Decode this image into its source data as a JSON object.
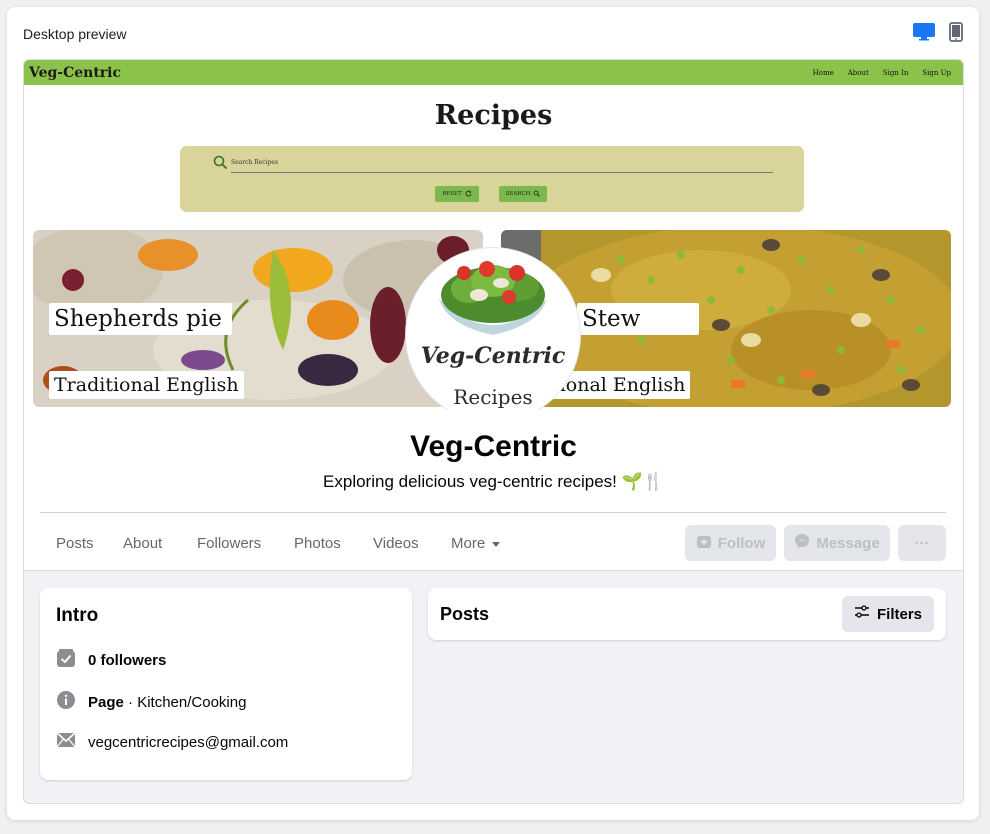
{
  "preview": {
    "title": "Desktop preview",
    "desktop_icon": "desktop-monitor-icon",
    "mobile_icon": "mobile-phone-icon",
    "active_color": "#1877f2"
  },
  "site": {
    "brand": "Veg-Centric",
    "nav_links": [
      "Home",
      "About",
      "Sign In",
      "Sign Up"
    ],
    "heading": "Recipes",
    "search_placeholder": "Search Recipes",
    "reset_label": "RESET",
    "search_label": "SEARCH",
    "accent": "#8bc34a",
    "search_bg": "#d9d49a"
  },
  "cards": [
    {
      "title": "Shepherds pie",
      "subtitle": "Traditional English"
    },
    {
      "title": "Stew",
      "subtitle": "itional English"
    }
  ],
  "logo": {
    "script_text": "Veg-Centric",
    "sub_text": "Recipes"
  },
  "page": {
    "name": "Veg-Centric",
    "description": "Exploring delicious veg-centric recipes! 🌱🍴"
  },
  "tabs": [
    "Posts",
    "About",
    "Followers",
    "Photos",
    "Videos",
    "More"
  ],
  "actions": {
    "follow": "Follow",
    "message": "Message",
    "more": "···"
  },
  "intro": {
    "title": "Intro",
    "followers": "0 followers",
    "page_label": "Page",
    "category": " · Kitchen/Cooking",
    "email": "vegcentricrecipes@gmail.com"
  },
  "posts": {
    "title": "Posts",
    "filters_label": "Filters"
  }
}
